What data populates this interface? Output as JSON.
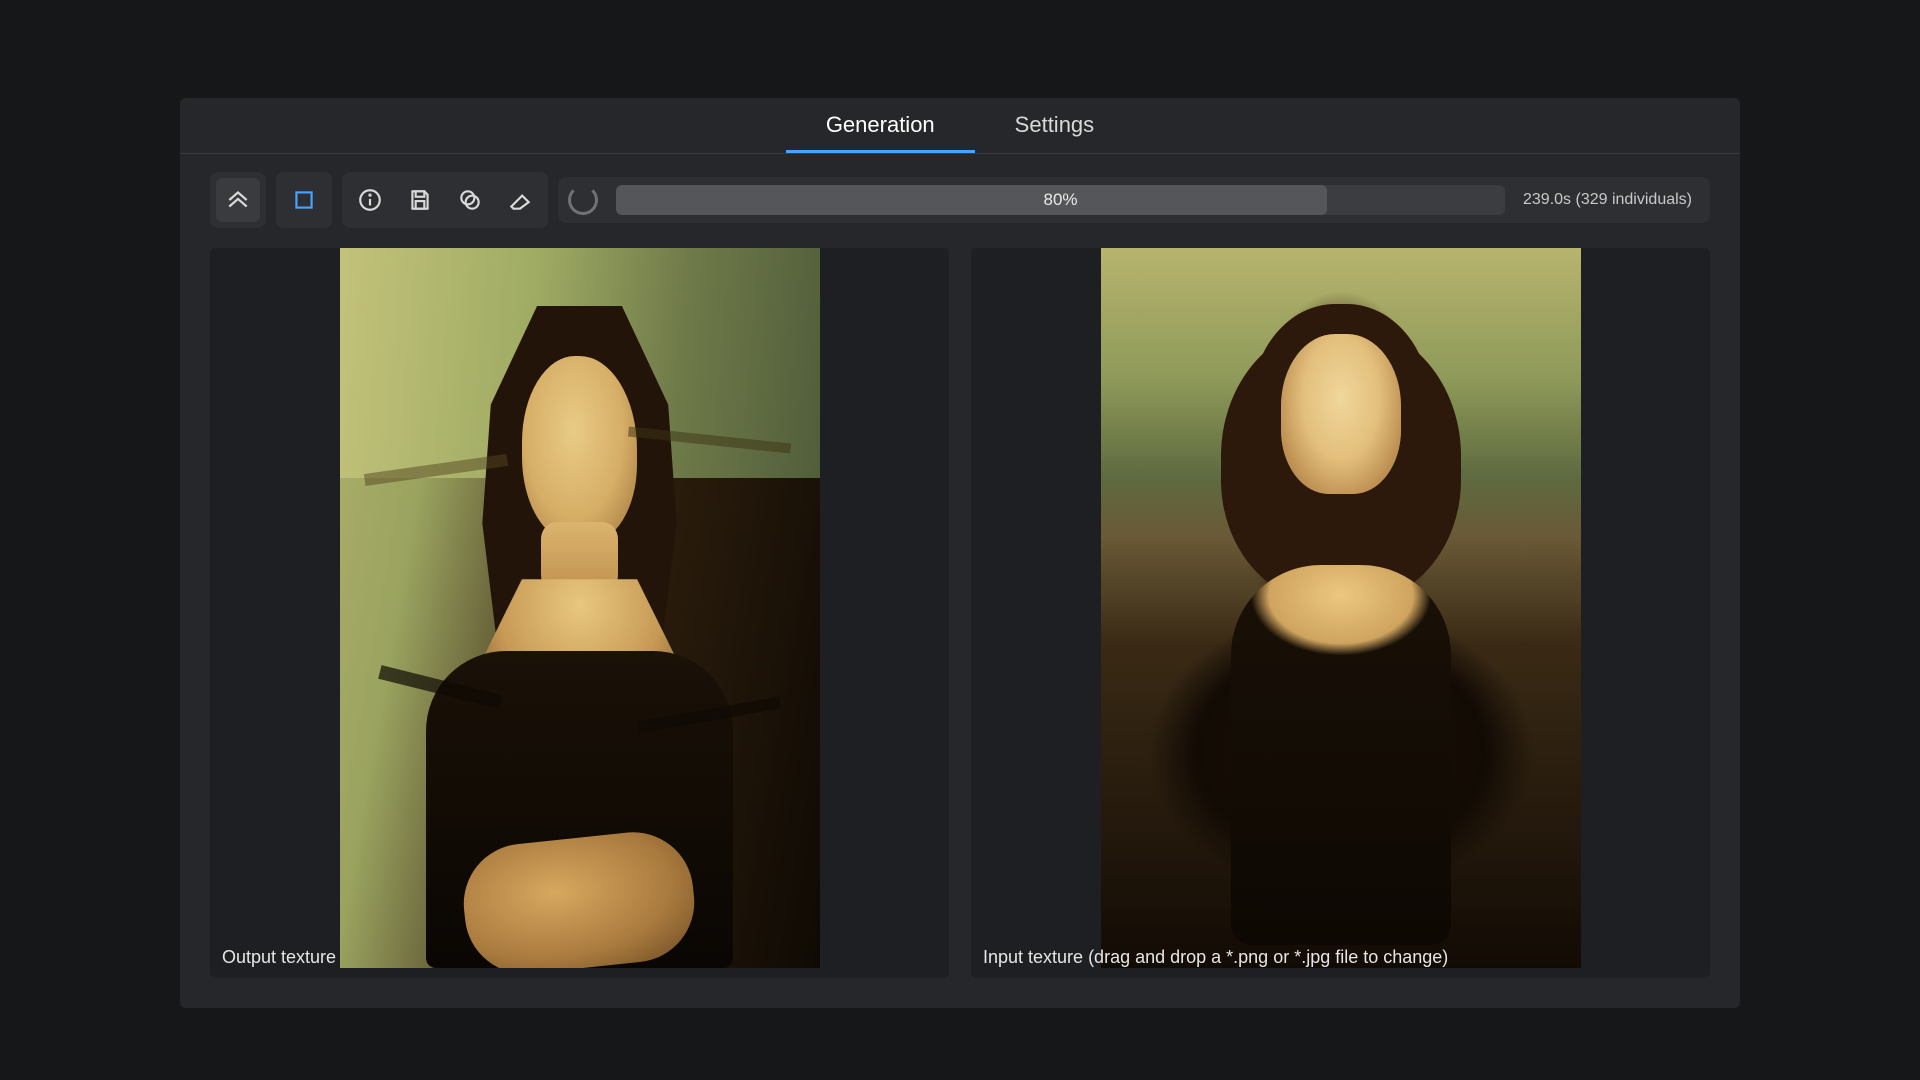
{
  "tabs": {
    "generation": "Generation",
    "settings": "Settings",
    "active": "generation"
  },
  "toolbar": {
    "icons": {
      "home": "home-icon",
      "stop": "stop-icon",
      "info": "info-icon",
      "save": "save-icon",
      "layers": "layers-icon",
      "erase": "eraser-icon"
    }
  },
  "progress": {
    "percent": 80,
    "label": "80%",
    "stats": "239.0s (329 individuals)"
  },
  "panes": {
    "output_label": "Output texture",
    "input_label": "Input texture (drag and drop a *.png or *.jpg file to change)"
  }
}
